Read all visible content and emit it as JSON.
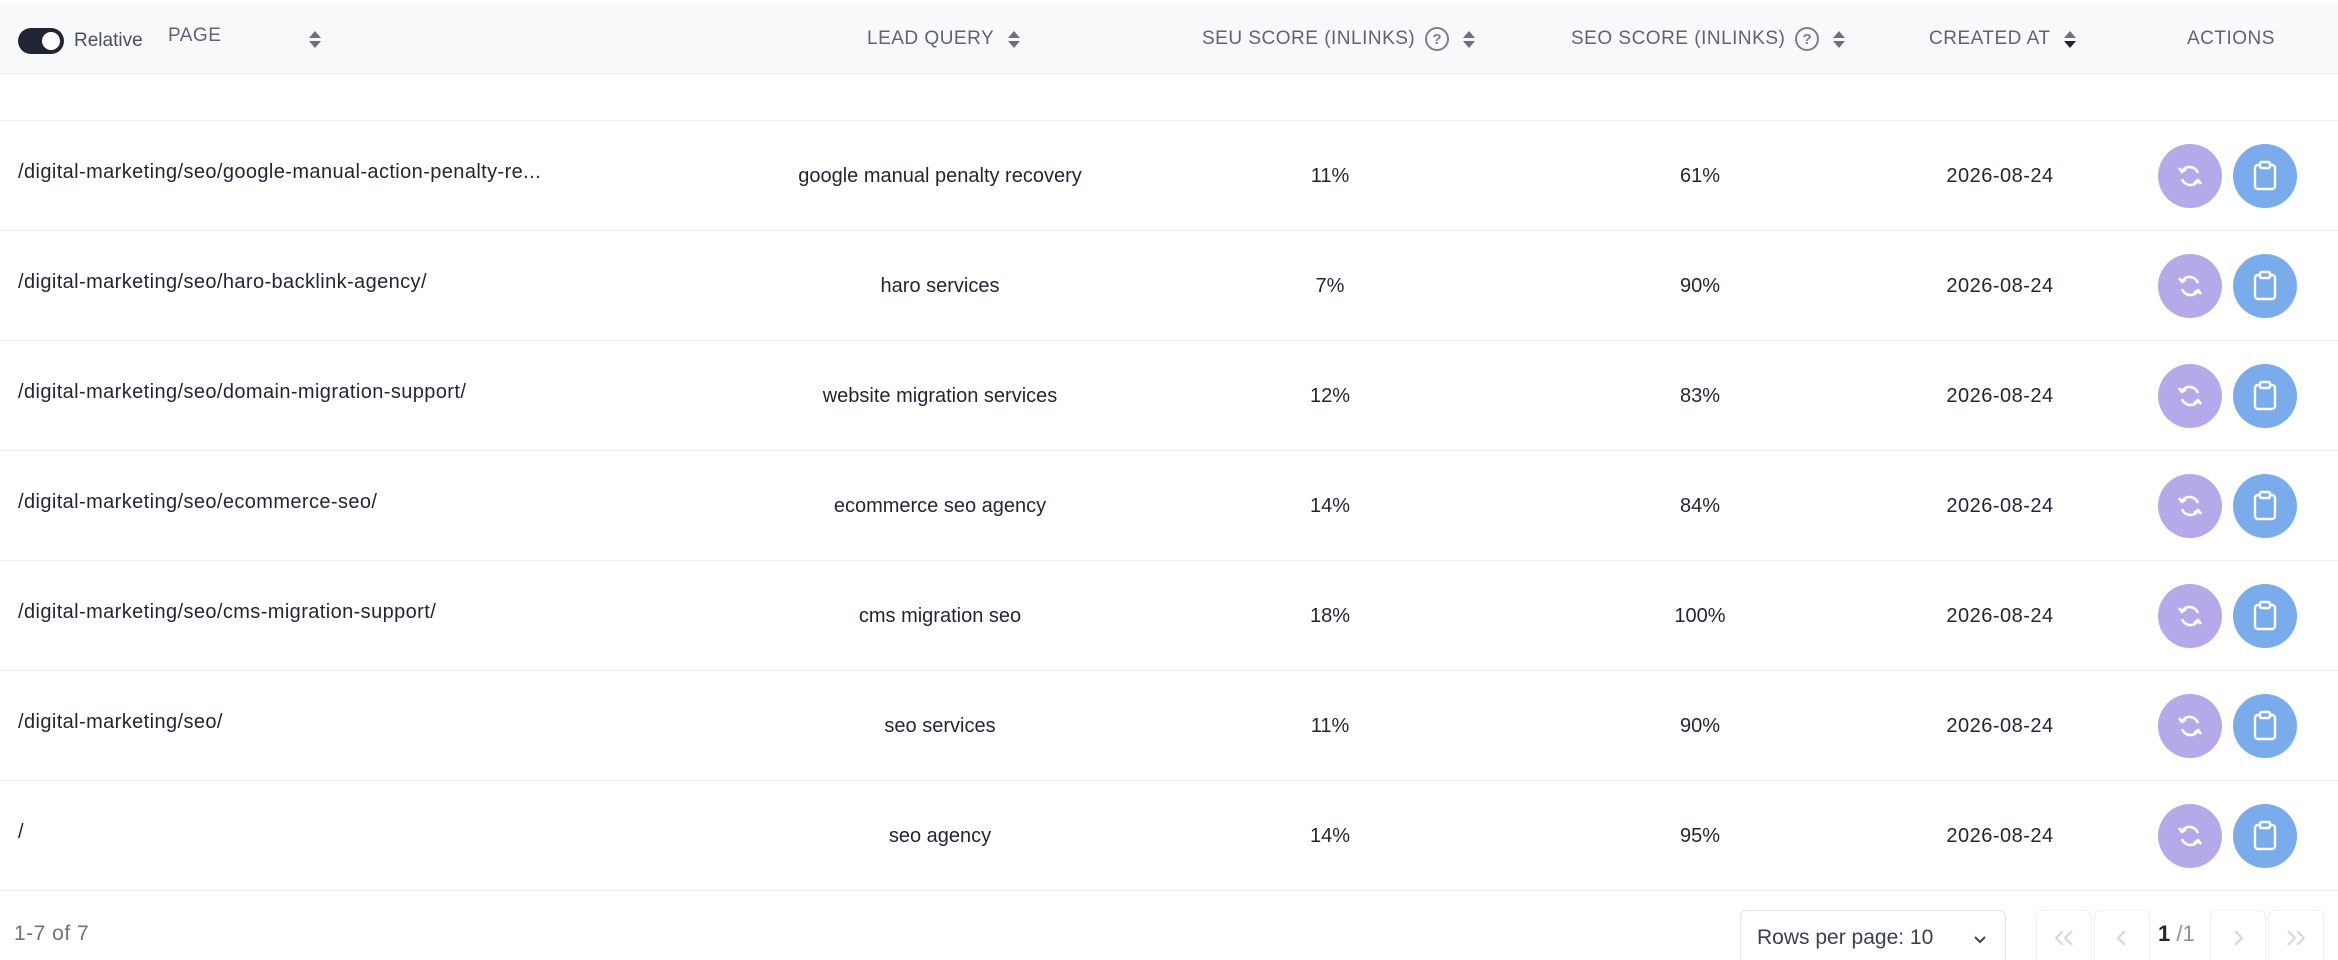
{
  "header": {
    "toggle_label": "Relative",
    "columns": {
      "page": "PAGE",
      "lead_query": "LEAD QUERY",
      "seu_score": "SEU SCORE (INLINKS)",
      "seo_score": "SEO SCORE (INLINKS)",
      "created_at": "CREATED AT",
      "actions": "ACTIONS"
    },
    "help_glyph": "?"
  },
  "rows": [
    {
      "page": "/digital-marketing/seo/google-manual-action-penalty-re...",
      "query": "google manual penalty recovery",
      "seu": "11%",
      "seo": "61%",
      "date": "2026-08-24"
    },
    {
      "page": "/digital-marketing/seo/haro-backlink-agency/",
      "query": "haro services",
      "seu": "7%",
      "seo": "90%",
      "date": "2026-08-24"
    },
    {
      "page": "/digital-marketing/seo/domain-migration-support/",
      "query": "website migration services",
      "seu": "12%",
      "seo": "83%",
      "date": "2026-08-24"
    },
    {
      "page": "/digital-marketing/seo/ecommerce-seo/",
      "query": "ecommerce seo agency",
      "seu": "14%",
      "seo": "84%",
      "date": "2026-08-24"
    },
    {
      "page": "/digital-marketing/seo/cms-migration-support/",
      "query": "cms migration seo",
      "seu": "18%",
      "seo": "100%",
      "date": "2026-08-24"
    },
    {
      "page": "/digital-marketing/seo/",
      "query": "seo services",
      "seu": "11%",
      "seo": "90%",
      "date": "2026-08-24"
    },
    {
      "page": "/",
      "query": "seo agency",
      "seu": "14%",
      "seo": "95%",
      "date": "2026-08-24"
    }
  ],
  "icons": {
    "refresh": "refresh-icon",
    "clipboard": "clipboard-icon"
  },
  "colors": {
    "refresh_button": "#b5a9ea",
    "clipboard_button": "#7aacec",
    "toggle_on": "#1f2533"
  },
  "footer": {
    "count": "1-7 of 7",
    "rows_per_page": "Rows per page: 10",
    "current_page": "1",
    "total_pages": "/1"
  }
}
